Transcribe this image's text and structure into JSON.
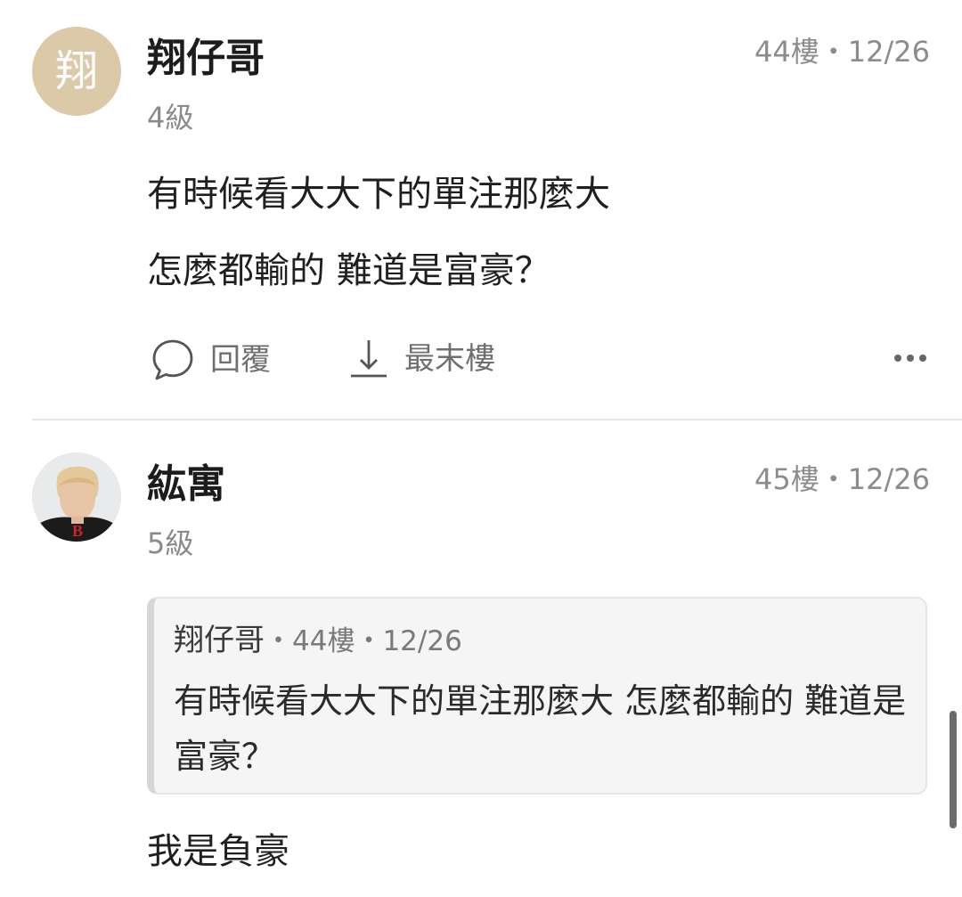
{
  "comments": [
    {
      "avatar_letter": "翔",
      "author": "翔仔哥",
      "level": "4級",
      "floor": "44樓",
      "date": "12/26",
      "lines": [
        "有時候看大大下的單注那麼大",
        "怎麼都輸的 難道是富豪？"
      ],
      "actions": {
        "reply_label": "回覆",
        "last_floor_label": "最末樓"
      }
    },
    {
      "author": "紘寓",
      "level": "5級",
      "floor": "45樓",
      "date": "12/26",
      "quote": {
        "author": "翔仔哥",
        "floor": "44樓",
        "date": "12/26",
        "text": "有時候看大大下的單注那麼大 怎麼都輸的 難道是富豪？"
      },
      "lines": [
        "我是負豪"
      ]
    }
  ],
  "separator": "・",
  "icons": {
    "reply": "speech-bubble-icon",
    "last_floor": "arrow-down-icon",
    "more": "more-dots-icon"
  },
  "colors": {
    "avatar_bg": "#dcc9a8",
    "meta_text": "#8c8c8c",
    "divider": "#e6e6e6",
    "quote_bg": "#f5f5f5"
  }
}
